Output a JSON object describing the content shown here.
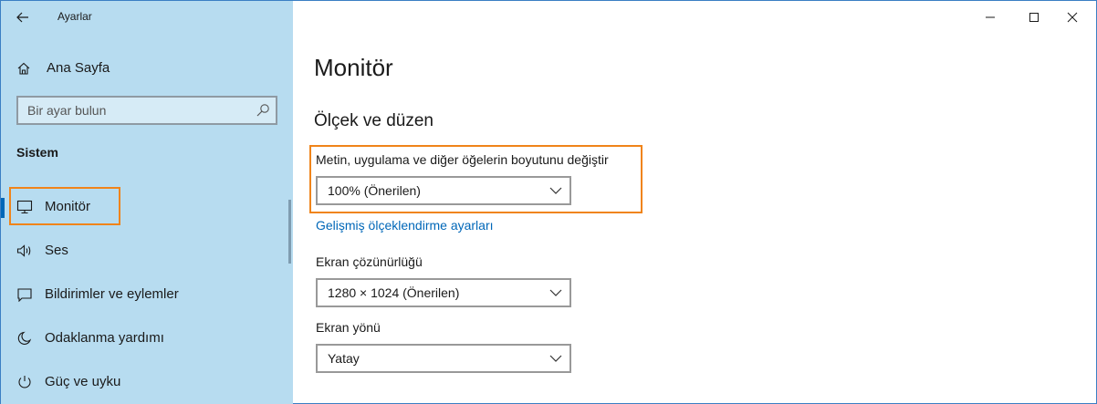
{
  "window": {
    "app_title": "Ayarlar",
    "controls": [
      "minimize-icon",
      "maximize-icon",
      "close-icon"
    ]
  },
  "sidebar": {
    "back_icon": "back-arrow-icon",
    "home": {
      "label": "Ana Sayfa",
      "icon": "home-icon"
    },
    "search": {
      "placeholder": "Bir ayar bulun",
      "icon": "search-icon"
    },
    "section_title": "Sistem",
    "items": [
      {
        "label": "Monitör",
        "icon": "monitor-icon",
        "selected": true
      },
      {
        "label": "Ses",
        "icon": "speaker-icon"
      },
      {
        "label": "Bildirimler ve eylemler",
        "icon": "notification-icon"
      },
      {
        "label": "Odaklanma yardımı",
        "icon": "moon-icon"
      },
      {
        "label": "Güç ve uyku",
        "icon": "power-icon"
      }
    ]
  },
  "main": {
    "title": "Monitör",
    "section": "Ölçek ve düzen",
    "scale": {
      "label": "Metin, uygulama ve diğer öğelerin boyutunu değiştir",
      "value": "100% (Önerilen)"
    },
    "advanced_link": "Gelişmiş ölçeklendirme ayarları",
    "resolution": {
      "label": "Ekran çözünürlüğü",
      "value": "1280 × 1024 (Önerilen)"
    },
    "orientation": {
      "label": "Ekran yönü",
      "value": "Yatay"
    }
  },
  "colors": {
    "sidebar_bg": "#b7dcf0",
    "accent": "#0067b8",
    "highlight": "#f0841a"
  }
}
